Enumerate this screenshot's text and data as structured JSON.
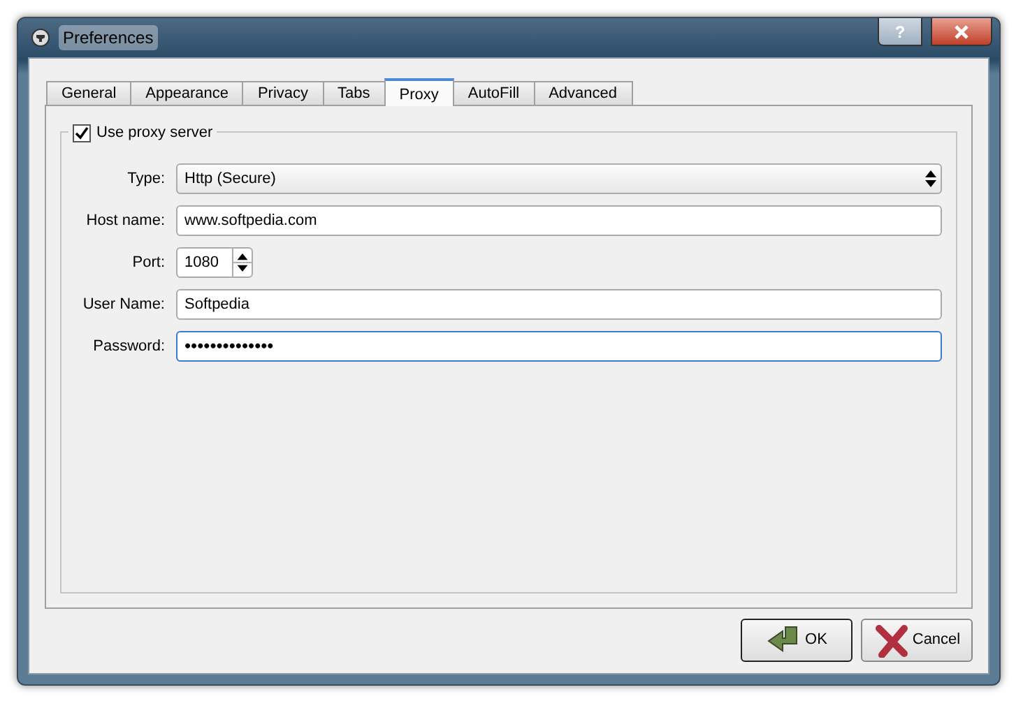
{
  "window": {
    "title": "Preferences"
  },
  "title_buttons": [
    "?"
  ],
  "tabs": [
    {
      "label": "General",
      "selected": false
    },
    {
      "label": "Appearance",
      "selected": false
    },
    {
      "label": "Privacy",
      "selected": false
    },
    {
      "label": "Tabs",
      "selected": false
    },
    {
      "label": "Proxy",
      "selected": true
    },
    {
      "label": "AutoFill",
      "selected": false
    },
    {
      "label": "Advanced",
      "selected": false
    }
  ],
  "proxy_group": {
    "label": "Use proxy server",
    "checked": true,
    "fields": [
      {
        "kind": "combo",
        "label": "Type:",
        "value": "Http (Secure)",
        "focused": false
      },
      {
        "kind": "text",
        "label": "Host name:",
        "value": "www.softpedia.com",
        "focused": false
      },
      {
        "kind": "spin",
        "label": "Port:",
        "value": "1080",
        "focused": false
      },
      {
        "kind": "text",
        "label": "User Name:",
        "value": "Softpedia",
        "focused": false
      },
      {
        "kind": "password",
        "label": "Password:",
        "value": "••••••••••••••",
        "focused": true
      }
    ]
  },
  "buttons": [
    {
      "kind": "ok",
      "label": "OK",
      "default": true
    },
    {
      "kind": "cancel",
      "label": "Cancel",
      "default": false
    }
  ]
}
